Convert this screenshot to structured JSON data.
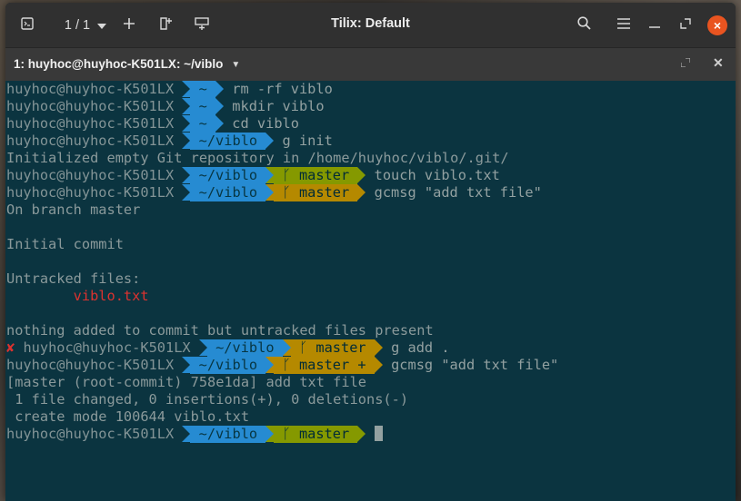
{
  "window": {
    "title": "Tilix: Default",
    "session_count": "1 / 1"
  },
  "tab": {
    "title": "1: huyhoc@huyhoc-K501LX: ~/viblo"
  },
  "terminal": {
    "lines": [
      {
        "type": "prompt",
        "user": "huyhoc@huyhoc-K501LX",
        "dir": "~",
        "branch": "",
        "cmd": "rm -rf viblo"
      },
      {
        "type": "prompt",
        "user": "huyhoc@huyhoc-K501LX",
        "dir": "~",
        "branch": "",
        "cmd": "mkdir viblo"
      },
      {
        "type": "prompt",
        "user": "huyhoc@huyhoc-K501LX",
        "dir": "~",
        "branch": "",
        "cmd": "cd viblo"
      },
      {
        "type": "prompt",
        "user": "huyhoc@huyhoc-K501LX",
        "dir": "~/viblo",
        "branch": "",
        "cmd": "g init"
      },
      {
        "type": "text",
        "text": "Initialized empty Git repository in /home/huyhoc/viblo/.git/"
      },
      {
        "type": "prompt",
        "user": "huyhoc@huyhoc-K501LX",
        "dir": "~/viblo",
        "branch": "master",
        "branch_color": "green",
        "cmd": "touch viblo.txt"
      },
      {
        "type": "prompt",
        "user": "huyhoc@huyhoc-K501LX",
        "dir": "~/viblo",
        "branch": "master",
        "branch_color": "yellow",
        "cmd": "gcmsg \"add txt file\""
      },
      {
        "type": "text",
        "text": "On branch master"
      },
      {
        "type": "text",
        "text": ""
      },
      {
        "type": "text",
        "text": "Initial commit"
      },
      {
        "type": "text",
        "text": ""
      },
      {
        "type": "text",
        "text": "Untracked files:"
      },
      {
        "type": "red",
        "text": "        viblo.txt"
      },
      {
        "type": "text",
        "text": ""
      },
      {
        "type": "text",
        "text": "nothing added to commit but untracked files present"
      },
      {
        "type": "prompt",
        "error": "✘",
        "user": "huyhoc@huyhoc-K501LX",
        "dir": "~/viblo",
        "branch": "master",
        "branch_color": "yellow",
        "cmd": "g add ."
      },
      {
        "type": "prompt",
        "user": "huyhoc@huyhoc-K501LX",
        "dir": "~/viblo",
        "branch": "master +",
        "branch_color": "yellow",
        "cmd": "gcmsg \"add txt file\""
      },
      {
        "type": "text",
        "text": "[master (root-commit) 758e1da] add txt file"
      },
      {
        "type": "text",
        "text": " 1 file changed, 0 insertions(+), 0 deletions(-)"
      },
      {
        "type": "text",
        "text": " create mode 100644 viblo.txt"
      },
      {
        "type": "prompt",
        "user": "huyhoc@huyhoc-K501LX",
        "dir": "~/viblo",
        "branch": "master",
        "branch_color": "green",
        "cmd": "",
        "cursor": true
      }
    ]
  },
  "colors": {
    "terminal_bg": "#0b3440",
    "dir_segment": "#268bd2",
    "branch_clean": "#859900",
    "branch_dirty": "#b58900",
    "error": "#dc322f",
    "close_button": "#e95420"
  },
  "icons": {
    "terminal": "terminal-icon",
    "dropdown": "chevron-down-icon",
    "add": "plus-icon",
    "sidebar": "add-terminal-right-icon",
    "split": "add-terminal-down-icon",
    "search": "search-icon",
    "menu": "hamburger-menu-icon",
    "maximize": "maximize-icon",
    "close": "close-icon",
    "branch": "git-branch-icon"
  }
}
